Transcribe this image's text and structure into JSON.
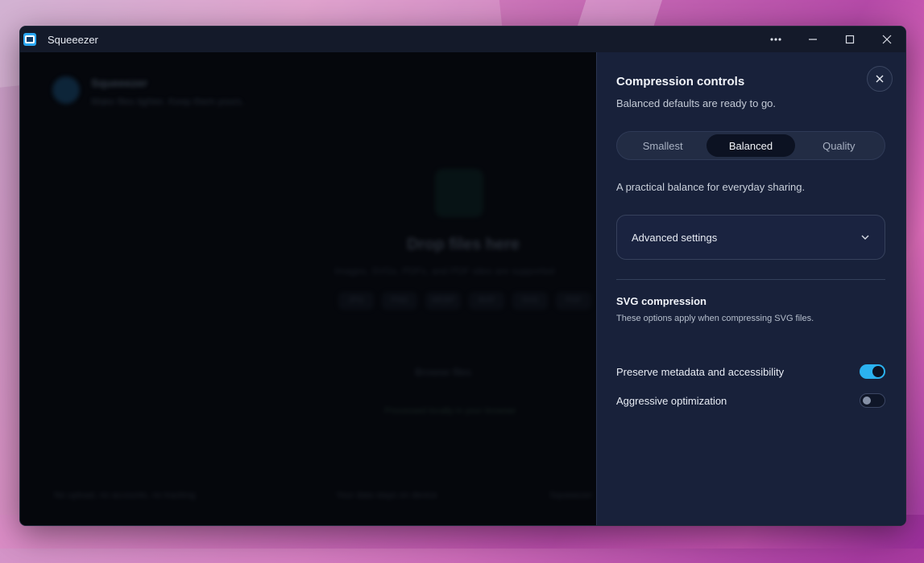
{
  "window": {
    "title": "Squeeezer"
  },
  "background_app": {
    "title": "Squeeezer",
    "subtitle": "Make files lighter. Keep them yours.",
    "drop_title": "Drop files here",
    "drop_subtitle": "Images, SVGs, PDFs, and PDF sites are supported",
    "formats": [
      "JPG",
      "PNG",
      "WEBP",
      "AVIF",
      "SVG",
      "PDF"
    ],
    "browse_label": "Browse files",
    "processed_note": "Processed locally in your browser",
    "footer": [
      "No upload, no accounts, no tracking",
      "Your data stays on device",
      "Squeeezer"
    ]
  },
  "panel": {
    "title": "Compression controls",
    "subtitle": "Balanced defaults are ready to go.",
    "presets": [
      "Smallest",
      "Balanced",
      "Quality"
    ],
    "active_preset": "Balanced",
    "preset_description": "A practical balance for everyday sharing.",
    "advanced_label": "Advanced settings",
    "svg_section": {
      "title": "SVG compression",
      "subtitle": "These options apply when compressing SVG files.",
      "options": [
        {
          "label": "Preserve metadata and accessibility",
          "enabled": true
        },
        {
          "label": "Aggressive optimization",
          "enabled": false
        }
      ]
    }
  },
  "colors": {
    "accent": "#2bb2f0",
    "panel_bg": "#18213a",
    "titlebar_bg": "#141a2a"
  }
}
